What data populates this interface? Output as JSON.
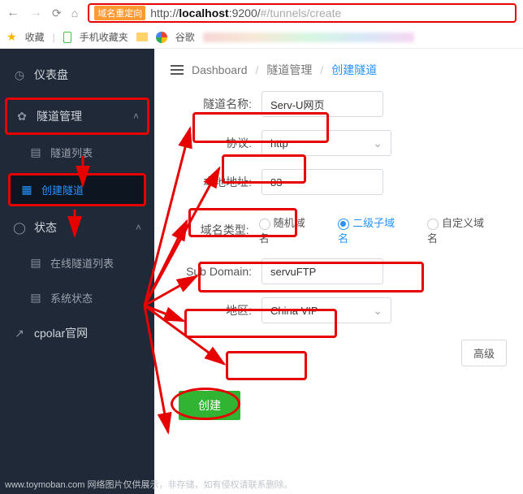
{
  "browser": {
    "redirect_tag": "域名重定向",
    "url_prefix": "http://",
    "url_host": "localhost",
    "url_port": ":9200",
    "url_hash_start": "/",
    "url_path": "#/tunnels/create"
  },
  "bookmarks": {
    "favorites": "收藏",
    "mobile_fav": "手机收藏夹",
    "google": "谷歌"
  },
  "sidebar": {
    "dashboard": "仪表盘",
    "tunnel_mgmt": "隧道管理",
    "tunnel_list": "隧道列表",
    "create_tunnel": "创建隧道",
    "status": "状态",
    "online_list": "在线隧道列表",
    "system_status": "系统状态",
    "cpolar_site": "cpolar官网"
  },
  "crumbs": {
    "dashboard": "Dashboard",
    "tunnel_mgmt": "隧道管理",
    "create_tunnel": "创建隧道"
  },
  "form": {
    "name_label": "隧道名称:",
    "name_value": "Serv-U网页",
    "proto_label": "协议:",
    "proto_value": "http",
    "addr_label": "本地地址:",
    "addr_value": "83",
    "domain_type_label": "域名类型:",
    "radio_random": "随机域名",
    "radio_subdomain": "二级子域名",
    "radio_custom": "自定义域名",
    "subdomain_label": "Sub Domain:",
    "subdomain_value": "servuFTP",
    "region_label": "地区:",
    "region_value": "China VIP",
    "advanced_btn": "高级",
    "create_btn": "创建"
  },
  "footer": "www.toymoban.com 网络图片仅供展示，非存储，如有侵权请联系删除。"
}
